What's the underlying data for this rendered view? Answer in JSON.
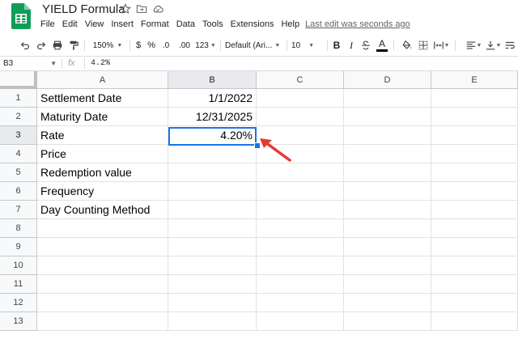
{
  "app": {
    "title": "YIELD Formula",
    "menu": [
      "File",
      "Edit",
      "View",
      "Insert",
      "Format",
      "Data",
      "Tools",
      "Extensions",
      "Help"
    ],
    "last_edit": "Last edit was seconds ago"
  },
  "toolbar": {
    "zoom": "150%",
    "currency": "$",
    "percent": "%",
    "decrease_decimal": ".0",
    "increase_decimal": ".00",
    "more_formats": "123",
    "font": "Default (Ari...",
    "font_size": "10",
    "bold": "B",
    "italic": "I",
    "text_color": "A"
  },
  "formula_bar": {
    "name_box": "B3",
    "fx": "fx",
    "value": "4.2%"
  },
  "columns": [
    "A",
    "B",
    "C",
    "D",
    "E"
  ],
  "rows": [
    "1",
    "2",
    "3",
    "4",
    "5",
    "6",
    "7",
    "8",
    "9",
    "10",
    "11",
    "12",
    "13"
  ],
  "cells": {
    "A1": "Settlement Date",
    "B1": "1/1/2022",
    "A2": "Maturity Date",
    "B2": "12/31/2025",
    "A3": "Rate",
    "B3": "4.20%",
    "A4": "Price",
    "A5": "Redemption value",
    "A6": "Frequency",
    "A7": "Day Counting Method"
  },
  "selected_cell": "B3",
  "colors": {
    "selection": "#1a73e8",
    "annotation_arrow": "#e53935",
    "sheets_green": "#0f9d58"
  }
}
